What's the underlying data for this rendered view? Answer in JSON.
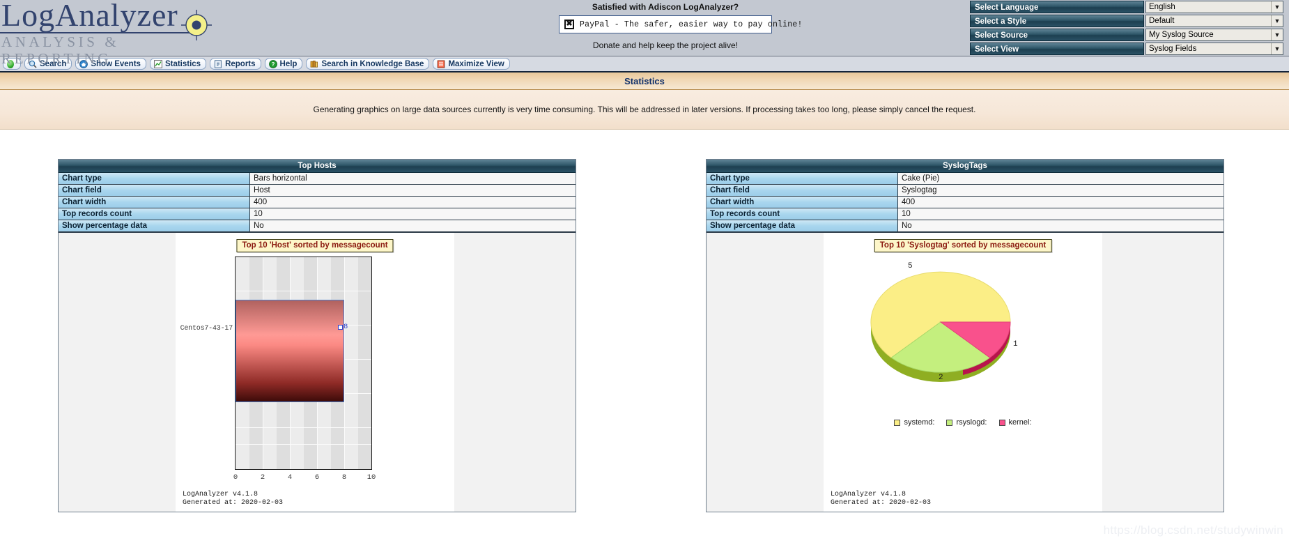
{
  "brand": {
    "name_part1": "Log",
    "name_part2": "Analyzer",
    "tagline": "ANALYSIS & REPORTING"
  },
  "donate": {
    "question": "Satisfied with Adiscon LogAnalyzer?",
    "paypal_icon": "paypal-x-icon",
    "paypal_text": "PayPal - The safer, easier way to pay online!",
    "footer": "Donate and help keep the project alive!"
  },
  "selectors": [
    {
      "label": "Select Language",
      "value": "English"
    },
    {
      "label": "Select a Style",
      "value": "Default"
    },
    {
      "label": "Select Source",
      "value": "My Syslog Source"
    },
    {
      "label": "Select View",
      "value": "Syslog Fields"
    }
  ],
  "toolbar": [
    {
      "icon": "status-online-icon",
      "label": ""
    },
    {
      "icon": "magnifier-icon",
      "label": "Search"
    },
    {
      "icon": "home-events-icon",
      "label": "Show Events"
    },
    {
      "icon": "chart-icon",
      "label": "Statistics"
    },
    {
      "icon": "report-icon",
      "label": "Reports"
    },
    {
      "icon": "help-icon",
      "label": "Help"
    },
    {
      "icon": "books-icon",
      "label": "Search in Knowledge Base"
    },
    {
      "icon": "maximize-icon",
      "label": "Maximize View"
    }
  ],
  "page": {
    "title": "Statistics",
    "notice": "Generating graphics on large data sources currently is very time consuming. This will be addressed in later versions. If processing takes too long, please simply cancel the request."
  },
  "panels": {
    "left": {
      "heading": "Top Hosts",
      "rows": [
        {
          "key": "Chart type",
          "value": "Bars horizontal"
        },
        {
          "key": "Chart field",
          "value": "Host"
        },
        {
          "key": "Chart width",
          "value": "400"
        },
        {
          "key": "Top records count",
          "value": "10"
        },
        {
          "key": "Show percentage data",
          "value": "No"
        }
      ],
      "footer": "LogAnalyzer v4.1.8\nGenerated at: 2020-02-03"
    },
    "right": {
      "heading": "SyslogTags",
      "rows": [
        {
          "key": "Chart type",
          "value": "Cake (Pie)"
        },
        {
          "key": "Chart field",
          "value": "Syslogtag"
        },
        {
          "key": "Chart width",
          "value": "400"
        },
        {
          "key": "Top records count",
          "value": "10"
        },
        {
          "key": "Show percentage data",
          "value": "No"
        }
      ],
      "footer": "LogAnalyzer v4.1.8\nGenerated at: 2020-02-03"
    }
  },
  "watermark": "https://blog.csdn.net/studywinwin",
  "chart_data": [
    {
      "type": "bar",
      "orientation": "horizontal",
      "title": "Top 10 'Host' sorted by messagecount",
      "categories": [
        "Centos7-43-17"
      ],
      "values": [
        8
      ],
      "xlabel": "",
      "ylabel": "",
      "xlim": [
        0,
        10
      ],
      "xticks": [
        0,
        2,
        4,
        6,
        8,
        10
      ],
      "grid": true,
      "bar_color": "#ff948e",
      "bar_border": "#4a7fd0",
      "value_label_color": "#2b3fd0",
      "footer": "LogAnalyzer v4.1.8  Generated at: 2020-02-03"
    },
    {
      "type": "pie",
      "title": "Top 10 'Syslogtag' sorted by messagecount",
      "labels": [
        "systemd:",
        "rsyslogd:",
        "kernel:"
      ],
      "values": [
        5,
        2,
        1
      ],
      "colors": [
        "#fbee86",
        "#c4ef7e",
        "#f9518c"
      ],
      "legend_position": "bottom",
      "slice_labels": [
        "5",
        "2",
        "1"
      ],
      "footer": "LogAnalyzer v4.1.8  Generated at: 2020-02-03"
    }
  ]
}
